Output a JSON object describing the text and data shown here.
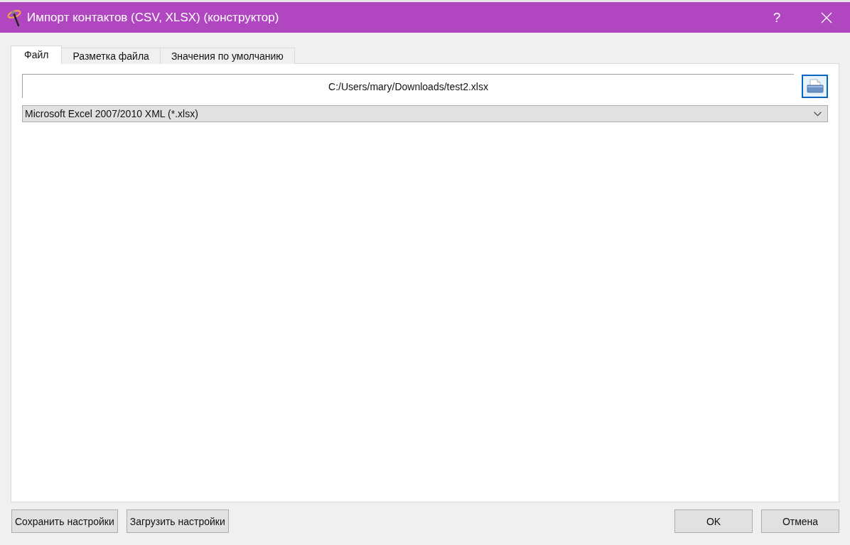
{
  "window": {
    "title": "Импорт контактов (CSV, XLSX) (конструктор)",
    "help": "?"
  },
  "tabs": [
    {
      "label": "Файл",
      "selected": true
    },
    {
      "label": "Разметка файла",
      "selected": false
    },
    {
      "label": "Значения по умолчанию",
      "selected": false
    }
  ],
  "file_path": {
    "value": "C:/Users/mary/Downloads/test2.xlsx"
  },
  "format": {
    "value": "Microsoft Excel 2007/2010 XML (*.xlsx)"
  },
  "buttons_left": [
    "Сохранить настройки",
    "Загрузить настройки"
  ],
  "buttons_right": [
    "OK",
    "Отмена"
  ]
}
